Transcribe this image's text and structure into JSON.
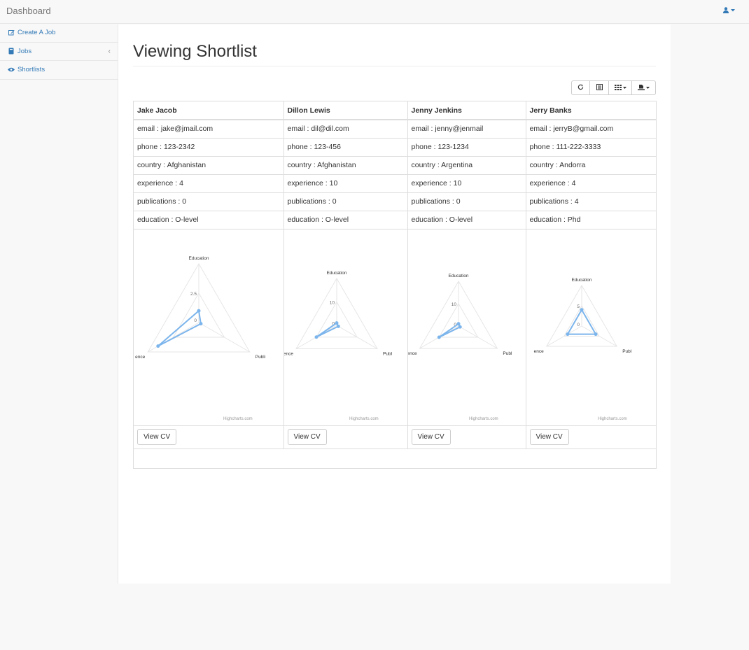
{
  "navbar": {
    "brand": "Dashboard"
  },
  "sidebar": {
    "items": [
      {
        "label": "Create A Job",
        "icon": "edit-icon"
      },
      {
        "label": "Jobs",
        "icon": "book-icon"
      },
      {
        "label": "Shortlists",
        "icon": "eye-icon"
      }
    ]
  },
  "page": {
    "title": "Viewing Shortlist"
  },
  "toolbar": {
    "icons": [
      "refresh-icon",
      "toggle-view-icon",
      "columns-icon",
      "export-icon"
    ]
  },
  "colors": {
    "accent": "#337ab7",
    "series": "#7cb5ec"
  },
  "candidates": [
    {
      "name": "Jake Jacob",
      "fields": [
        "email : jake@jmail.com",
        "phone : 123-2342",
        "country : Afghanistan",
        "experience : 4",
        "publications : 0",
        "education : O-level"
      ],
      "button": "View CV"
    },
    {
      "name": "Dillon Lewis",
      "fields": [
        "email : dil@dil.com",
        "phone : 123-456",
        "country : Afghanistan",
        "experience : 10",
        "publications : 0",
        "education : O-level"
      ],
      "button": "View CV"
    },
    {
      "name": "Jenny Jenkins",
      "fields": [
        "email : jenny@jenmail",
        "phone : 123-1234",
        "country : Argentina",
        "experience : 10",
        "publications : 0",
        "education : O-level"
      ],
      "button": "View CV"
    },
    {
      "name": "Jerry Banks",
      "fields": [
        "email : jerryB@gmail.com",
        "phone : 111-222-3333",
        "country : Andorra",
        "experience : 4",
        "publications : 4",
        "education : Phd"
      ],
      "button": "View CV"
    }
  ],
  "chart_data": [
    {
      "type": "radar",
      "categories": [
        "Education",
        "Publi",
        "ence"
      ],
      "ticks": [
        "2.5",
        "0"
      ],
      "ylim": [
        0,
        5
      ],
      "values": [
        1,
        0,
        4
      ],
      "credit": "Highcharts.com"
    },
    {
      "type": "radar",
      "categories": [
        "Education",
        "Publ",
        "ence"
      ],
      "ticks": [
        "10",
        "0"
      ],
      "ylim": [
        0,
        20
      ],
      "values": [
        1,
        0,
        10
      ],
      "credit": "Highcharts.com"
    },
    {
      "type": "radar",
      "categories": [
        "Education",
        "Publ",
        "ence"
      ],
      "ticks": [
        "10",
        "0"
      ],
      "ylim": [
        0,
        20
      ],
      "values": [
        1,
        0,
        10
      ],
      "credit": "Highcharts.com"
    },
    {
      "type": "radar",
      "categories": [
        "Education",
        "Publ",
        "ence"
      ],
      "ticks": [
        "5",
        "0"
      ],
      "ylim": [
        0,
        10
      ],
      "values": [
        4,
        4,
        4
      ],
      "credit": "Highcharts.com"
    }
  ]
}
